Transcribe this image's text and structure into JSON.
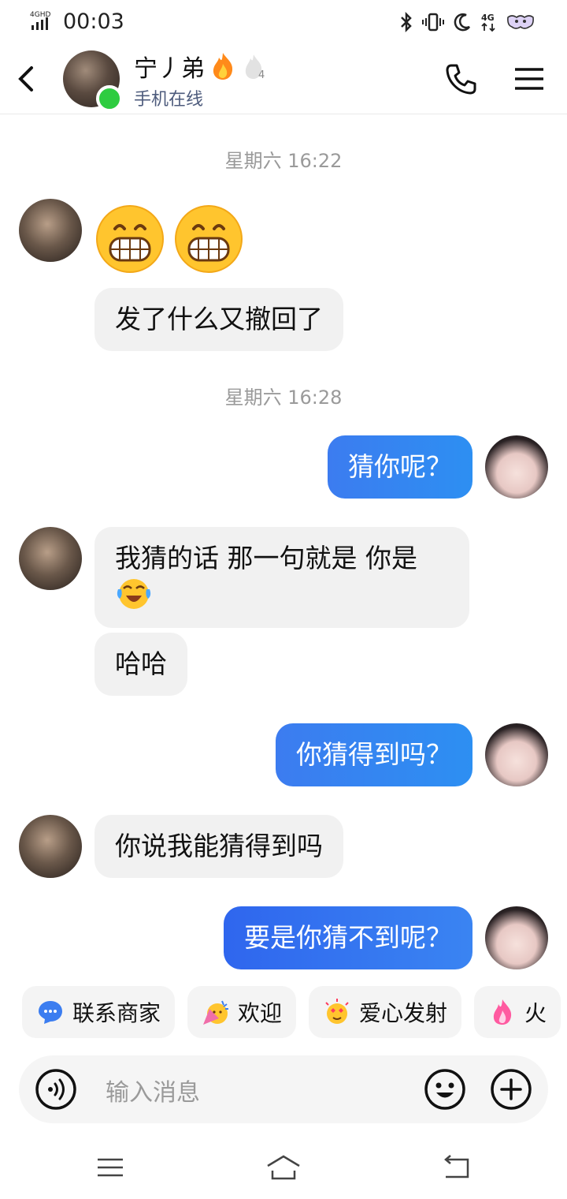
{
  "status_bar": {
    "time": "00:03",
    "network": "4GHD",
    "mobile_badge": "4G"
  },
  "header": {
    "contact_name": "宁丿弟",
    "status": "手机在线",
    "badge_level": "4"
  },
  "messages": [
    {
      "type": "timestamp",
      "text": "星期六 16:22"
    },
    {
      "type": "emoji_in",
      "emojis": [
        "grinning-icon",
        "grinning-icon"
      ]
    },
    {
      "type": "in",
      "text": "发了什么又撤回了"
    },
    {
      "type": "timestamp",
      "text": "星期六 16:28"
    },
    {
      "type": "out",
      "text": "猜你呢？"
    },
    {
      "type": "in",
      "text": "我猜的话 那一句就是 你是"
    },
    {
      "type": "in",
      "text": "哈哈"
    },
    {
      "type": "out",
      "text": "你猜得到吗？"
    },
    {
      "type": "in",
      "text": "你说我能猜得到吗"
    },
    {
      "type": "out",
      "text": "要是你猜不到呢？"
    }
  ],
  "quick_actions": [
    {
      "label": "联系商家",
      "icon": "chat-bubble-icon"
    },
    {
      "label": "欢迎",
      "icon": "party-icon"
    },
    {
      "label": "爱心发射",
      "icon": "heart-face-icon"
    },
    {
      "label": "火",
      "icon": "flame-icon"
    }
  ],
  "input": {
    "placeholder": "输入消息"
  },
  "colors": {
    "bubble_out": "#2d8ff2",
    "bubble_in": "#f1f1f1",
    "online": "#2ecc40"
  }
}
